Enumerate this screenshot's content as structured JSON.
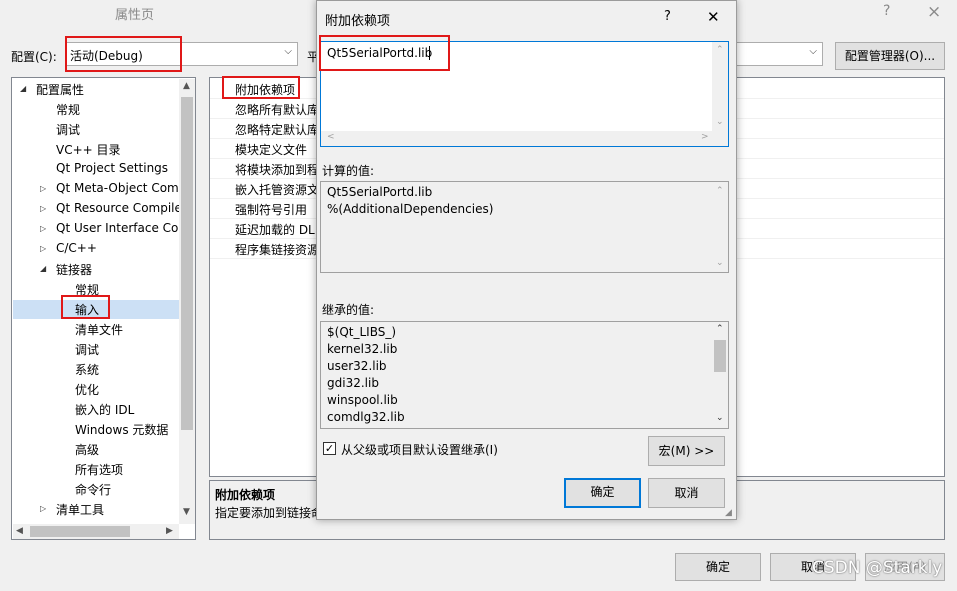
{
  "window": {
    "title": "属性页",
    "help_glyph": "?",
    "close_glyph": "×"
  },
  "config_bar": {
    "config_label": "配置(C):",
    "config_value": "活动(Debug)",
    "platform_label_fragment": "平",
    "manager_button": "配置管理器(O)..."
  },
  "tree": {
    "items": [
      {
        "label": "配置属性",
        "expander": "◢"
      },
      {
        "label": "常规"
      },
      {
        "label": "调试"
      },
      {
        "label": "VC++ 目录"
      },
      {
        "label": "Qt Project Settings"
      },
      {
        "label": "Qt Meta-Object Com",
        "expander": "▷"
      },
      {
        "label": "Qt Resource Compile",
        "expander": "▷"
      },
      {
        "label": "Qt User Interface Co",
        "expander": "▷"
      },
      {
        "label": "C/C++",
        "expander": "▷"
      },
      {
        "label": "链接器",
        "expander": "◢"
      },
      {
        "label": "常规"
      },
      {
        "label": "输入"
      },
      {
        "label": "清单文件"
      },
      {
        "label": "调试"
      },
      {
        "label": "系统"
      },
      {
        "label": "优化"
      },
      {
        "label": "嵌入的 IDL"
      },
      {
        "label": "Windows 元数据"
      },
      {
        "label": "高级"
      },
      {
        "label": "所有选项"
      },
      {
        "label": "命令行"
      },
      {
        "label": "清单工具",
        "expander": "▷"
      }
    ]
  },
  "grid": {
    "rows": [
      "附加依赖项",
      "忽略所有默认库",
      "忽略特定默认库",
      "模块定义文件",
      "将模块添加到程",
      "嵌入托管资源文",
      "强制符号引用",
      "延迟加载的 DL",
      "程序集链接资源"
    ]
  },
  "description": {
    "title": "附加依赖项",
    "text": "指定要添加到链接命"
  },
  "dialog": {
    "title": "附加依赖项",
    "help_glyph": "?",
    "close_glyph": "✕",
    "edit_value": "Qt5SerialPortd.lib",
    "computed_label": "计算的值:",
    "computed_values": [
      "Qt5SerialPortd.lib",
      "%(AdditionalDependencies)"
    ],
    "inherited_label": "继承的值:",
    "inherited_values": [
      "$(Qt_LIBS_)",
      "kernel32.lib",
      "user32.lib",
      "gdi32.lib",
      "winspool.lib",
      "comdlg32.lib"
    ],
    "inherit_checkbox_label": "从父级或项目默认设置继承(I)",
    "inherit_checked": true,
    "macro_button": "宏(M) >>",
    "ok_button": "确定",
    "cancel_button": "取消"
  },
  "footer": {
    "ok_button": "确定",
    "cancel_button": "取消",
    "apply_button": "应用(A)"
  },
  "watermark": "CSDN @Starkly",
  "colors": {
    "selection": "#cce0f5",
    "highlight_red": "#e01818",
    "default_button_border": "#0078d7"
  }
}
